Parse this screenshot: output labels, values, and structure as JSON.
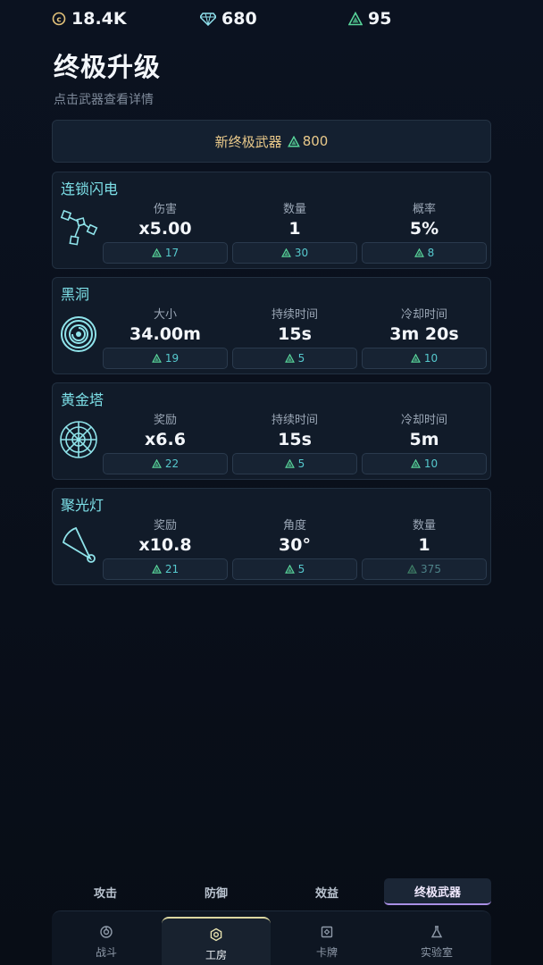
{
  "currency": {
    "coins": "18.4K",
    "gems": "680",
    "triangles": "95"
  },
  "page": {
    "title": "终极升级",
    "subtitle": "点击武器查看详情"
  },
  "new_weapon": {
    "label": "新终极武器",
    "cost": "800"
  },
  "weapons": [
    {
      "name": "连锁闪电",
      "stats": [
        {
          "label": "伤害",
          "value": "x5.00",
          "cost": "17"
        },
        {
          "label": "数量",
          "value": "1",
          "cost": "30"
        },
        {
          "label": "概率",
          "value": "5%",
          "cost": "8"
        }
      ]
    },
    {
      "name": "黑洞",
      "stats": [
        {
          "label": "大小",
          "value": "34.00m",
          "cost": "19"
        },
        {
          "label": "持续时间",
          "value": "15s",
          "cost": "5"
        },
        {
          "label": "冷却时间",
          "value": "3m 20s",
          "cost": "10"
        }
      ]
    },
    {
      "name": "黄金塔",
      "stats": [
        {
          "label": "奖励",
          "value": "x6.6",
          "cost": "22"
        },
        {
          "label": "持续时间",
          "value": "15s",
          "cost": "5"
        },
        {
          "label": "冷却时间",
          "value": "5m",
          "cost": "10"
        }
      ]
    },
    {
      "name": "聚光灯",
      "stats": [
        {
          "label": "奖励",
          "value": "x10.8",
          "cost": "21"
        },
        {
          "label": "角度",
          "value": "30°",
          "cost": "5"
        },
        {
          "label": "数量",
          "value": "1",
          "cost": "375"
        }
      ]
    }
  ],
  "category_tabs": [
    "攻击",
    "防御",
    "效益",
    "终极武器"
  ],
  "nav": [
    "战斗",
    "工房",
    "卡牌",
    "实验室"
  ],
  "colors": {
    "accent_cyan": "#7de0e8",
    "cost_teal": "#56c9ce",
    "gold": "#e9c98a",
    "tab_accent": "#a98fe4"
  }
}
